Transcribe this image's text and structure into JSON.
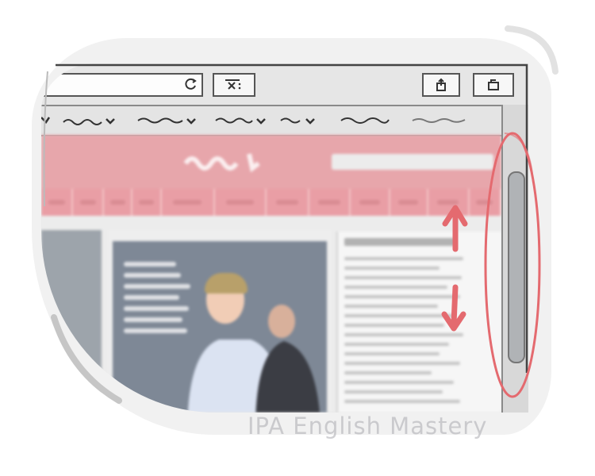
{
  "browser": {
    "toolbar": {
      "reload_icon": "reload-icon",
      "stop_icon": "stop-icon",
      "home_icon": "home-icon",
      "tab_icon": "tab-icon"
    },
    "menu_icons": [
      "chevron-down-icon",
      "chevron-down-icon",
      "chevron-down-icon",
      "chevron-down-icon"
    ]
  },
  "annotations": {
    "arrow_up": "arrow-up-icon",
    "arrow_down": "arrow-down-icon",
    "highlight_color": "#e46a6f"
  },
  "colors": {
    "site_header": "#e7a6ab",
    "site_nav": "#e99ea5",
    "scrollbar_thumb": "#b0b3b6"
  },
  "watermark": "IPA English Mastery"
}
